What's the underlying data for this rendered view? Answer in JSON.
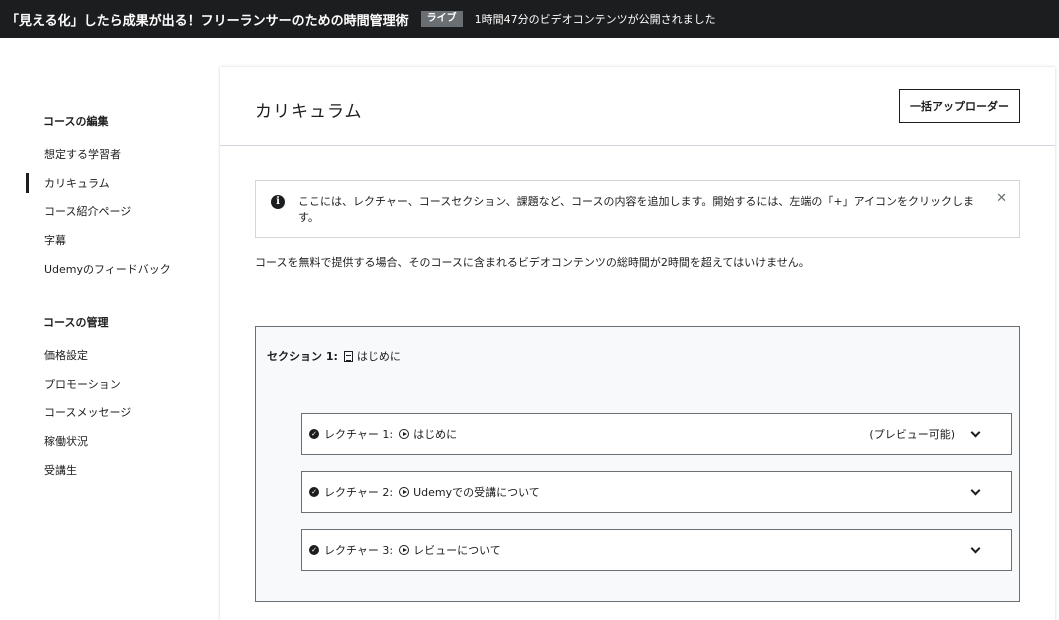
{
  "topbar": {
    "course_title": "「見える化」したら成果が出る！フリーランサーのための時間管理術",
    "badge": "ライブ",
    "status": "1時間47分のビデオコンテンツが公開されました"
  },
  "sidebar": {
    "edit_heading": "コースの編集",
    "edit_items": [
      {
        "label": "想定する学習者",
        "active": false
      },
      {
        "label": "カリキュラム",
        "active": true
      },
      {
        "label": "コース紹介ページ",
        "active": false
      },
      {
        "label": "字幕",
        "active": false
      },
      {
        "label": "Udemyのフィードバック",
        "active": false
      }
    ],
    "manage_heading": "コースの管理",
    "manage_items": [
      {
        "label": "価格設定"
      },
      {
        "label": "プロモーション"
      },
      {
        "label": "コースメッセージ"
      },
      {
        "label": "稼働状況"
      },
      {
        "label": "受講生"
      }
    ]
  },
  "main": {
    "title": "カリキュラム",
    "bulk_uploader": "一括アップローダー",
    "info": "ここには、レクチャー、コースセクション、課題など、コースの内容を追加します。開始するには、左端の「+」アイコンをクリックします。",
    "notice": "コースを無料で提供する場合、そのコースに含まれるビデオコンテンツの総時間が2時間を超えてはいけません。",
    "section": {
      "label": "セクション 1:",
      "title": "はじめに",
      "lectures": [
        {
          "label": "レクチャー 1:",
          "title": "はじめに",
          "preview": "(プレビュー可能)"
        },
        {
          "label": "レクチャー 2:",
          "title": "Udemyでの受講について",
          "preview": ""
        },
        {
          "label": "レクチャー 3:",
          "title": "レビューについて",
          "preview": ""
        }
      ]
    }
  },
  "icons": {
    "info": "info-icon",
    "close": "close-icon",
    "check": "check-circle-icon",
    "play": "play-circle-icon",
    "document": "document-icon",
    "chevron": "chevron-down-icon"
  }
}
